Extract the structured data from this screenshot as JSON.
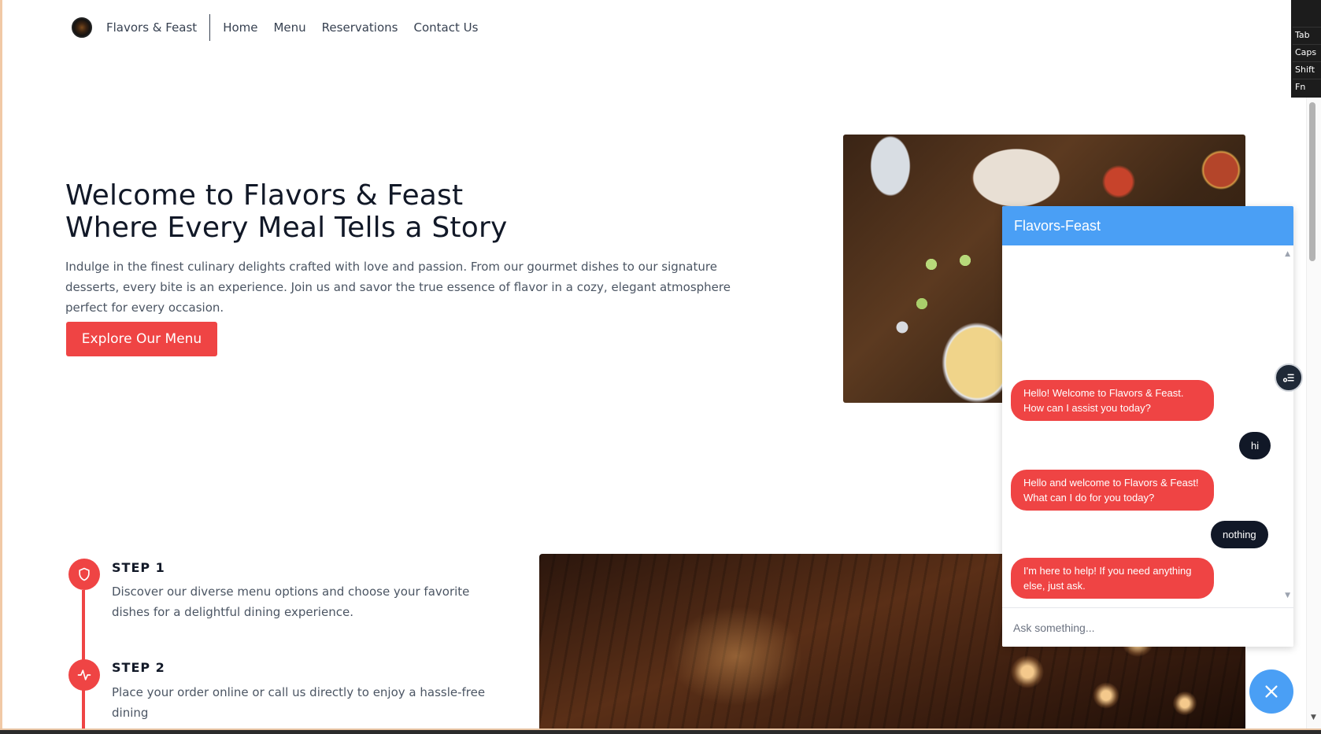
{
  "nav": {
    "brand": "Flavors & Feast",
    "links": [
      "Home",
      "Menu",
      "Reservations",
      "Contact Us"
    ]
  },
  "hero": {
    "title_line1": "Welcome to Flavors & Feast",
    "title_line2": "Where Every Meal Tells a Story",
    "description": "Indulge in the finest culinary delights crafted with love and passion. From our gourmet dishes to our signature desserts, every bite is an experience. Join us and savor the true essence of flavor in a cozy, elegant atmosphere perfect for every occasion.",
    "cta_label": "Explore Our Menu"
  },
  "steps": [
    {
      "title": "STEP 1",
      "description": "Discover our diverse menu options and choose your favorite dishes for a delightful dining experience.",
      "icon": "shield-icon"
    },
    {
      "title": "STEP 2",
      "description": "Place your order online or call us directly to enjoy a hassle-free dining",
      "icon": "activity-icon"
    }
  ],
  "chat": {
    "title": "Flavors-Feast",
    "messages": [
      {
        "from": "bot",
        "text": "Hello! Welcome to Flavors & Feast. How can I assist you today?"
      },
      {
        "from": "user",
        "text": "hi"
      },
      {
        "from": "bot",
        "text": "Hello and welcome to Flavors & Feast! What can I do for you today?"
      },
      {
        "from": "user",
        "text": "nothing"
      },
      {
        "from": "bot",
        "text": "I'm here to help! If you need anything else, just ask."
      }
    ],
    "input_placeholder": "Ask something..."
  },
  "keyboard": {
    "keys": [
      "Tab",
      "Caps",
      "Shift",
      "Fn"
    ]
  },
  "colors": {
    "accent_red": "#ef4444",
    "chat_blue": "#4a9ff5",
    "user_bubble": "#111827"
  }
}
